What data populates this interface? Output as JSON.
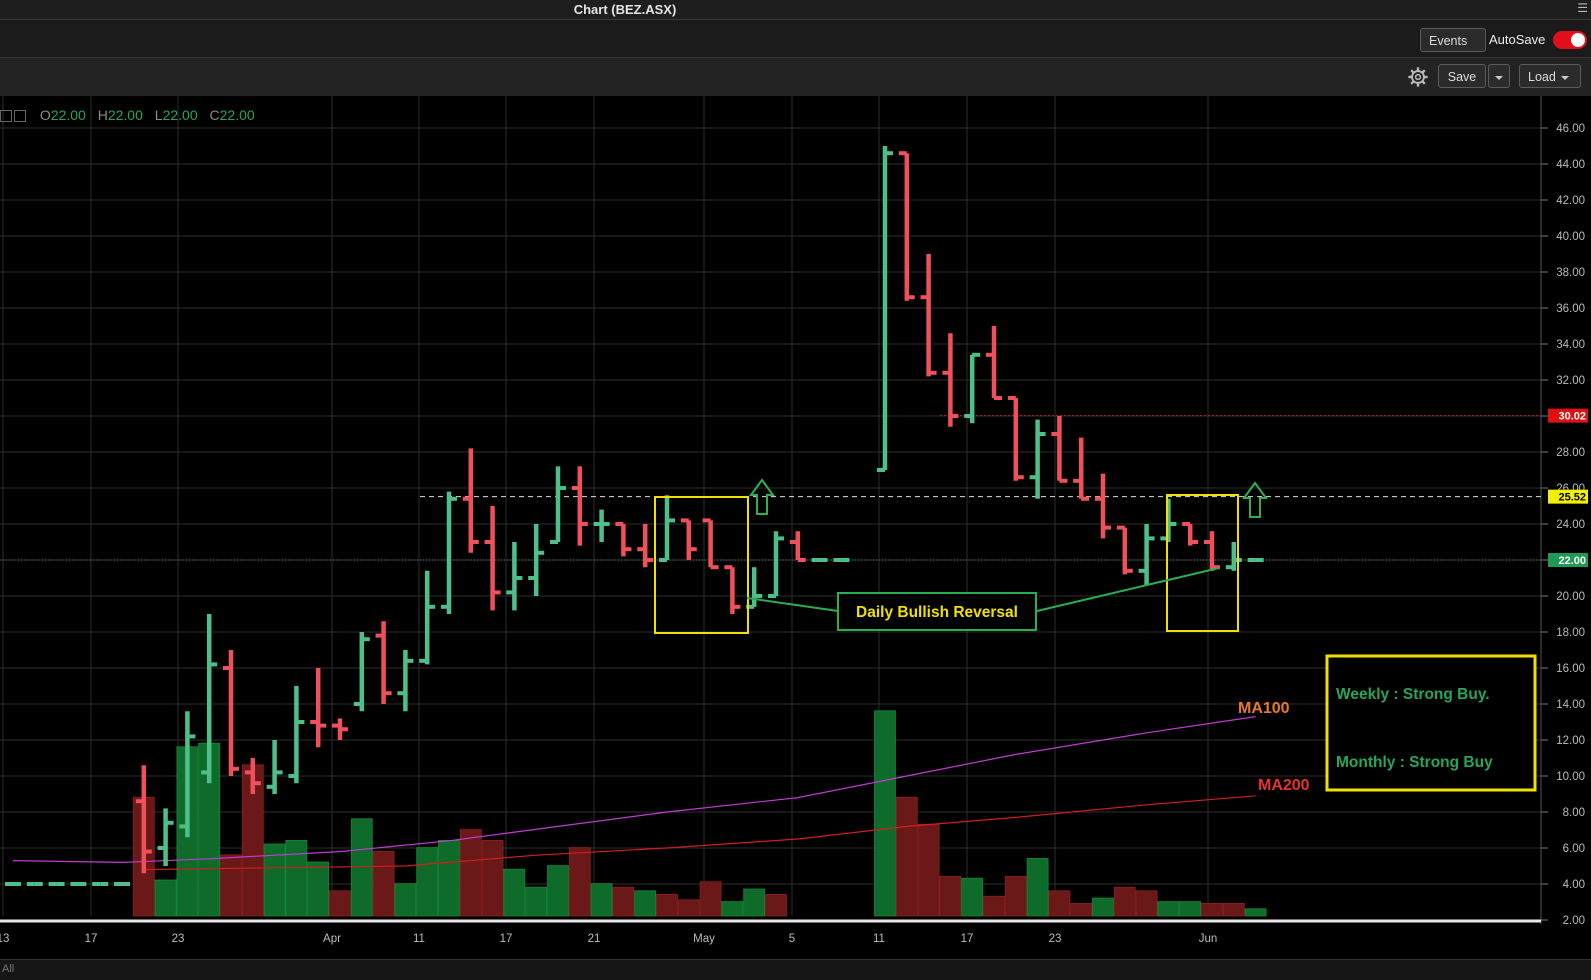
{
  "window": {
    "title": "Chart (BEZ.ASX)",
    "menu_icon": "hamburger-icon"
  },
  "toolbar": {
    "events_label": "Events",
    "autosave_label": "AutoSave",
    "autosave_on": true,
    "save_label": "Save",
    "load_label": "Load",
    "settings_icon": "gear-icon"
  },
  "ohlc_readout": {
    "o_key": "O",
    "o": "22.00",
    "h_key": "H",
    "h": "22.00",
    "l_key": "L",
    "l": "22.00",
    "c_key": "C",
    "c": "22.00"
  },
  "bottom_bar": {
    "range_label": "All"
  },
  "colors": {
    "up": "#26a65b",
    "down": "#f0505a",
    "ma100": "#c23bd4",
    "ma200": "#d21e1e",
    "annotation_yellow": "#f0e000",
    "annotation_green": "#26b050"
  },
  "chart_data": {
    "type": "bar",
    "subtype": "ohlc",
    "y_axis_ticks": [
      "2.00",
      "4.00",
      "6.00",
      "8.00",
      "10.00",
      "12.00",
      "14.00",
      "16.00",
      "18.00",
      "20.00",
      "22.00",
      "24.00",
      "26.00",
      "28.00",
      "30.00",
      "32.00",
      "34.00",
      "36.00",
      "38.00",
      "40.00",
      "42.00",
      "44.00",
      "46.00"
    ],
    "ylim": [
      1.5,
      47.5
    ],
    "x_tick_labels": [
      "13",
      "17",
      "23",
      "Apr",
      "11",
      "17",
      "21",
      "May",
      "5",
      "11",
      "17",
      "23",
      "Jun"
    ],
    "price_tags": [
      {
        "value": 30.02,
        "label": "30.02",
        "style": "red"
      },
      {
        "value": 25.52,
        "label": "25.52",
        "style": "yellow"
      },
      {
        "value": 22.0,
        "label": "22.00",
        "style": "green"
      }
    ],
    "bars": [
      {
        "o": 4,
        "h": 4,
        "l": 4,
        "c": 4
      },
      {
        "o": 4,
        "h": 4,
        "l": 4,
        "c": 4
      },
      {
        "o": 4,
        "h": 4,
        "l": 4,
        "c": 4
      },
      {
        "o": 4,
        "h": 4,
        "l": 4,
        "c": 4
      },
      {
        "o": 4,
        "h": 4,
        "l": 4,
        "c": 4
      },
      {
        "o": 4,
        "h": 4,
        "l": 4,
        "c": 4
      },
      {
        "o": 8.6,
        "h": 10.6,
        "l": 4.6,
        "c": 5.8
      },
      {
        "o": 6.0,
        "h": 8.2,
        "l": 5.0,
        "c": 7.4
      },
      {
        "o": 7.2,
        "h": 13.6,
        "l": 6.6,
        "c": 12.2
      },
      {
        "o": 10.2,
        "h": 19.0,
        "l": 9.6,
        "c": 16.2
      },
      {
        "o": 16.0,
        "h": 17.0,
        "l": 10.0,
        "c": 10.4
      },
      {
        "o": 10.2,
        "h": 11.0,
        "l": 9.0,
        "c": 9.6
      },
      {
        "o": 9.4,
        "h": 12.0,
        "l": 9.0,
        "c": 10.2
      },
      {
        "o": 10.0,
        "h": 15.0,
        "l": 9.6,
        "c": 13.0
      },
      {
        "o": 13.0,
        "h": 16.0,
        "l": 11.6,
        "c": 12.8
      },
      {
        "o": 12.8,
        "h": 13.2,
        "l": 12.0,
        "c": 12.6
      },
      {
        "o": 14.0,
        "h": 18.0,
        "l": 13.6,
        "c": 17.6
      },
      {
        "o": 17.8,
        "h": 18.6,
        "l": 14.0,
        "c": 14.6
      },
      {
        "o": 14.6,
        "h": 17.0,
        "l": 13.6,
        "c": 16.4
      },
      {
        "o": 16.4,
        "h": 21.4,
        "l": 16.2,
        "c": 19.4
      },
      {
        "o": 19.4,
        "h": 25.8,
        "l": 19.0,
        "c": 25.4
      },
      {
        "o": 25.4,
        "h": 28.2,
        "l": 22.4,
        "c": 23.0
      },
      {
        "o": 23.0,
        "h": 25.0,
        "l": 19.2,
        "c": 20.2
      },
      {
        "o": 20.2,
        "h": 23.0,
        "l": 19.2,
        "c": 21.0
      },
      {
        "o": 21.0,
        "h": 24.0,
        "l": 20.0,
        "c": 22.4
      },
      {
        "o": 23.0,
        "h": 27.2,
        "l": 23.0,
        "c": 26.0
      },
      {
        "o": 26.0,
        "h": 27.2,
        "l": 22.8,
        "c": 24.0
      },
      {
        "o": 24.0,
        "h": 24.8,
        "l": 23.0,
        "c": 24.0
      },
      {
        "o": 24.0,
        "h": 24.0,
        "l": 22.2,
        "c": 22.6
      },
      {
        "o": 22.6,
        "h": 24.0,
        "l": 21.6,
        "c": 22.0
      },
      {
        "o": 22.0,
        "h": 25.6,
        "l": 22.0,
        "c": 24.2
      },
      {
        "o": 24.2,
        "h": 24.2,
        "l": 22.0,
        "c": 22.6
      },
      {
        "o": 24.2,
        "h": 24.2,
        "l": 21.6,
        "c": 21.6
      },
      {
        "o": 21.6,
        "h": 21.6,
        "l": 19.0,
        "c": 19.4
      },
      {
        "o": 19.4,
        "h": 21.6,
        "l": 19.4,
        "c": 20.0
      },
      {
        "o": 20.0,
        "h": 23.6,
        "l": 20.0,
        "c": 23.2
      },
      {
        "o": 23.0,
        "h": 23.6,
        "l": 22.0,
        "c": 22.0
      },
      {
        "o": 22.0,
        "h": 22.0,
        "l": 22.0,
        "c": 22.0
      },
      {
        "o": 22.0,
        "h": 22.0,
        "l": 22.0,
        "c": 22.0
      },
      null,
      {
        "o": 27.0,
        "h": 45.0,
        "l": 27.0,
        "c": 44.6
      },
      {
        "o": 44.6,
        "h": 44.6,
        "l": 36.4,
        "c": 36.6
      },
      {
        "o": 36.6,
        "h": 39.0,
        "l": 32.2,
        "c": 32.4
      },
      {
        "o": 32.4,
        "h": 34.6,
        "l": 29.4,
        "c": 30.0
      },
      {
        "o": 30.0,
        "h": 33.4,
        "l": 29.6,
        "c": 33.4
      },
      {
        "o": 33.4,
        "h": 35.0,
        "l": 31.0,
        "c": 31.0
      },
      {
        "o": 31.0,
        "h": 31.0,
        "l": 26.4,
        "c": 26.6
      },
      {
        "o": 26.6,
        "h": 29.8,
        "l": 25.4,
        "c": 29.0
      },
      {
        "o": 29.0,
        "h": 30.0,
        "l": 26.4,
        "c": 26.4
      },
      {
        "o": 26.4,
        "h": 28.8,
        "l": 25.4,
        "c": 25.4
      },
      {
        "o": 25.4,
        "h": 26.8,
        "l": 23.2,
        "c": 23.8
      },
      {
        "o": 23.8,
        "h": 23.8,
        "l": 21.2,
        "c": 21.4
      },
      {
        "o": 21.4,
        "h": 24.0,
        "l": 20.6,
        "c": 23.2
      },
      {
        "o": 23.2,
        "h": 25.4,
        "l": 23.0,
        "c": 24.0
      },
      {
        "o": 24.0,
        "h": 24.0,
        "l": 22.8,
        "c": 23.0
      },
      {
        "o": 23.0,
        "h": 23.6,
        "l": 21.4,
        "c": 21.6
      },
      {
        "o": 21.6,
        "h": 23.0,
        "l": 21.4,
        "c": 22.0
      },
      {
        "o": 22.0,
        "h": 22.0,
        "l": 22.0,
        "c": 22.0
      }
    ],
    "volume_bars": [
      {
        "v": 0,
        "up": true
      },
      {
        "v": 0,
        "up": true
      },
      {
        "v": 0,
        "up": true
      },
      {
        "v": 0,
        "up": true
      },
      {
        "v": 0,
        "up": true
      },
      {
        "v": 0,
        "up": true
      },
      {
        "v": 6.6,
        "up": false
      },
      {
        "v": 2.0,
        "up": true
      },
      {
        "v": 9.4,
        "up": true
      },
      {
        "v": 9.6,
        "up": true
      },
      {
        "v": 3.4,
        "up": false
      },
      {
        "v": 8.4,
        "up": false
      },
      {
        "v": 4.0,
        "up": true
      },
      {
        "v": 4.2,
        "up": true
      },
      {
        "v": 3.0,
        "up": true
      },
      {
        "v": 1.4,
        "up": false
      },
      {
        "v": 5.4,
        "up": true
      },
      {
        "v": 3.6,
        "up": false
      },
      {
        "v": 1.8,
        "up": true
      },
      {
        "v": 3.8,
        "up": true
      },
      {
        "v": 4.2,
        "up": true
      },
      {
        "v": 4.8,
        "up": false
      },
      {
        "v": 4.2,
        "up": false
      },
      {
        "v": 2.6,
        "up": true
      },
      {
        "v": 1.6,
        "up": true
      },
      {
        "v": 2.8,
        "up": true
      },
      {
        "v": 3.8,
        "up": false
      },
      {
        "v": 1.8,
        "up": true
      },
      {
        "v": 1.6,
        "up": false
      },
      {
        "v": 1.4,
        "up": true
      },
      {
        "v": 1.2,
        "up": false
      },
      {
        "v": 0.9,
        "up": false
      },
      {
        "v": 1.9,
        "up": false
      },
      {
        "v": 0.8,
        "up": true
      },
      {
        "v": 1.5,
        "up": true
      },
      {
        "v": 1.2,
        "up": false
      },
      {
        "v": 0,
        "up": true
      },
      {
        "v": 0,
        "up": true
      },
      {
        "v": 0,
        "up": true
      },
      {
        "v": 0,
        "up": true
      },
      {
        "v": 11.4,
        "up": true
      },
      {
        "v": 6.6,
        "up": false
      },
      {
        "v": 5.1,
        "up": false
      },
      {
        "v": 2.2,
        "up": false
      },
      {
        "v": 2.1,
        "up": true
      },
      {
        "v": 1.1,
        "up": false
      },
      {
        "v": 2.2,
        "up": false
      },
      {
        "v": 3.2,
        "up": true
      },
      {
        "v": 1.4,
        "up": false
      },
      {
        "v": 0.7,
        "up": false
      },
      {
        "v": 1.0,
        "up": true
      },
      {
        "v": 1.6,
        "up": false
      },
      {
        "v": 1.4,
        "up": false
      },
      {
        "v": 0.8,
        "up": true
      },
      {
        "v": 0.8,
        "up": true
      },
      {
        "v": 0.7,
        "up": false
      },
      {
        "v": 0.7,
        "up": false
      },
      {
        "v": 0.4,
        "up": true
      }
    ],
    "ma100": [
      [
        0,
        5.3
      ],
      [
        5,
        5.2
      ],
      [
        9,
        5.4
      ],
      [
        15,
        5.8
      ],
      [
        20,
        6.4
      ],
      [
        25,
        7.2
      ],
      [
        30,
        8.0
      ],
      [
        36,
        8.8
      ],
      [
        41,
        10.0
      ],
      [
        46,
        11.2
      ],
      [
        52,
        12.4
      ],
      [
        57,
        13.3
      ]
    ],
    "ma200": [
      [
        6,
        4.8
      ],
      [
        12,
        4.9
      ],
      [
        18,
        5.0
      ],
      [
        24,
        5.6
      ],
      [
        30,
        6.0
      ],
      [
        36,
        6.5
      ],
      [
        41,
        7.2
      ],
      [
        46,
        7.7
      ],
      [
        52,
        8.4
      ],
      [
        57,
        8.9
      ]
    ],
    "annotations": {
      "ma100_label": "MA100",
      "ma200_label": "MA200",
      "reversal_label": "Daily Bullish Reversal",
      "signal_weekly": "Weekly : Strong Buy.",
      "signal_monthly": "Monthly : Strong Buy"
    }
  }
}
